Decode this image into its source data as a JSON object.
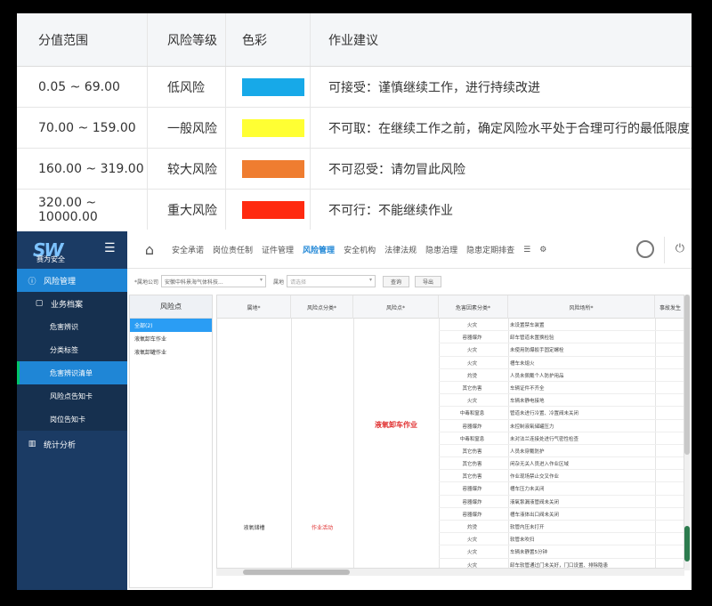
{
  "risk_table": {
    "headers": [
      "分值范围",
      "风险等级",
      "色彩",
      "作业建议"
    ],
    "rows": [
      {
        "range": "0.05 ~ 69.00",
        "level": "低风险",
        "color": "#17a9e8",
        "advice": "可接受：谨慎继续工作，进行持续改进"
      },
      {
        "range": "70.00 ~ 159.00",
        "level": "一般风险",
        "color": "#ffff33",
        "advice": "不可取：在继续工作之前，确定风险水平处于合理可行的最低限度"
      },
      {
        "range": "160.00 ~ 319.00",
        "level": "较大风险",
        "color": "#ef7d30",
        "advice": "不可忍受：请勿冒此风险"
      },
      {
        "range": "320.00 ~ 10000.00",
        "level": "重大风险",
        "color": "#ff2a10",
        "advice": "不可行：不能继续作业"
      }
    ]
  },
  "app": {
    "logo_mark": "SW",
    "logo_sub": "赛为安全",
    "sidebar": {
      "top_item": "风险管理",
      "group": "业务档案",
      "sub_items": [
        "危害辨识",
        "分类标签",
        "危害辨识清单",
        "风险点告知卡",
        "岗位告知卡"
      ],
      "active_sub": 2,
      "stats": "统计分析"
    },
    "nav": [
      "安全承诺",
      "岗位责任制",
      "证件管理",
      "风险管理",
      "安全机构",
      "法律法规",
      "隐患治理",
      "隐患定期排查"
    ],
    "nav_active": 3,
    "filter": {
      "company_label": "*属地公司",
      "company_value": "安徽中科景海气体科技...",
      "area_label": "属地",
      "area_placeholder": "请选择",
      "search_btn": "查询",
      "export_btn": "导出"
    },
    "tree": {
      "title": "风险点",
      "items": [
        "全部(2)",
        "液氧卸车作业",
        "液氧卸罐作业"
      ]
    },
    "grid": {
      "headers": [
        "属地*",
        "风险点分类*",
        "风险点*",
        "危害因素分类*",
        "风险场所*",
        "事故发生"
      ],
      "merged_area": "液氧储槽",
      "merged_class": "作业活动",
      "merged_point": "液氧卸车作业",
      "rows": [
        [
          "火灾",
          "未设置禁车装置"
        ],
        [
          "容器爆炸",
          "卸车管道未置换检验"
        ],
        [
          "火灾",
          "未使用防爆扳手固定螺栓"
        ],
        [
          "火灾",
          "槽车未熄火"
        ],
        [
          "灼烫",
          "人员未佩戴个人防护用品"
        ],
        [
          "其它伤害",
          "车辆证件不齐全"
        ],
        [
          "火灾",
          "车辆未静电接地"
        ],
        [
          "中毒和窒息",
          "管道未进行冷置、冷置阀未关闭"
        ],
        [
          "容器爆炸",
          "未控制液氧储罐压力"
        ],
        [
          "中毒和窒息",
          "未对法兰连接处进行气密性检查"
        ],
        [
          "其它伤害",
          "人员未穿戴防护"
        ],
        [
          "其它伤害",
          "闲杂无关人员进入作业区域"
        ],
        [
          "其它伤害",
          "作业现场禁止交叉作业"
        ],
        [
          "容器爆炸",
          "槽车压力未关闭"
        ],
        [
          "容器爆炸",
          "液氧泵漏液管阀未关闭"
        ],
        [
          "容器爆炸",
          "槽车液体出口阀未关闭"
        ],
        [
          "灼烫",
          "软管内压未打开"
        ],
        [
          "火灾",
          "软管未吹扫"
        ],
        [
          "火灾",
          "车辆未静置5分钟"
        ],
        [
          "火灾",
          "卸车软管通过门未关好，门口设置、排除隐患"
        ]
      ]
    }
  }
}
